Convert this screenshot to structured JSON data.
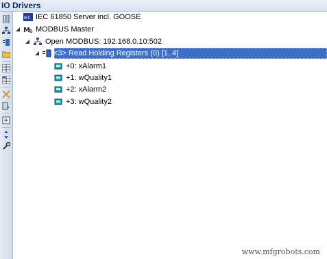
{
  "panel": {
    "title": "IO Drivers"
  },
  "toolbar": {
    "buttons": [
      "driver-list-icon",
      "network-tree-icon",
      "register-icon",
      "folder-open-icon",
      "grid-icon",
      "grid-alt-icon",
      "cross-icon",
      "import-icon",
      "add-icon",
      "up-down-icon",
      "wrench-icon"
    ]
  },
  "tree": {
    "iec_server": "IEC 61850 Server incl. GOOSE",
    "modbus_master": "MODBUS Master",
    "open_modbus": "Open MODBUS: 192.168.0.10:502",
    "read_holding": "<3> Read Holding Registers (0) [1..4]",
    "registers": [
      "+0: xAlarm1",
      "+1: wQuality1",
      "+2: xAlarm2",
      "+3: wQuality2"
    ]
  },
  "watermark": "www.mfgrobots.com"
}
